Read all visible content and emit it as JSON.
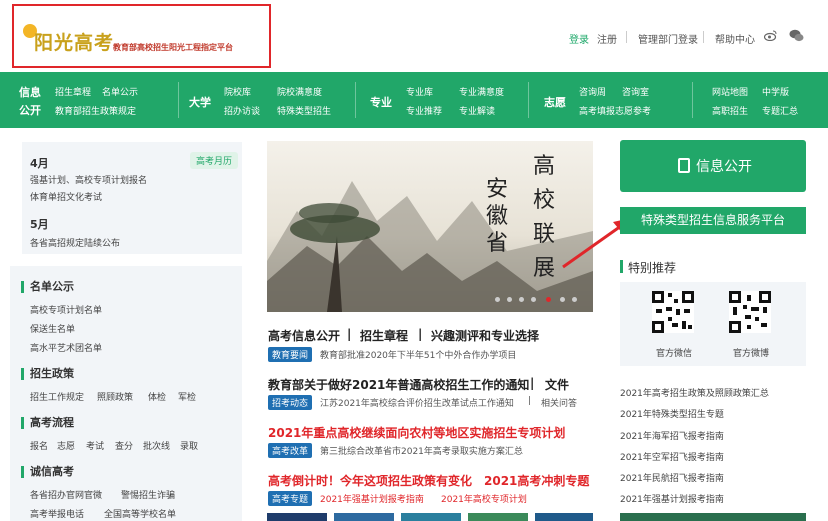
{
  "header": {
    "logo_text": "阳光高考",
    "logo_subtitle": "教育部高校招生阳光工程指定平台",
    "links": {
      "login": "登录",
      "register": "注册",
      "admin_login": "管理部门登录",
      "help": "帮助中心"
    }
  },
  "nav": {
    "groups": [
      {
        "title_line1": "信息",
        "title_line2": "公开",
        "items": [
          "招生章程",
          "名单公示",
          "教育部招生政策规定"
        ]
      },
      {
        "title": "大学",
        "items": [
          "院校库",
          "院校满意度",
          "招办访谈",
          "特殊类型招生"
        ]
      },
      {
        "title": "专业",
        "items": [
          "专业库",
          "专业满意度",
          "专业推荐",
          "专业解读"
        ]
      },
      {
        "title": "志愿",
        "items": [
          "咨询周",
          "咨询室",
          "高考填报志愿参考"
        ]
      },
      {
        "items": [
          "网站地图",
          "中学版",
          "高职招生",
          "专题汇总"
        ]
      }
    ]
  },
  "calendar": {
    "badge": "高考月历",
    "april": {
      "month": "4月",
      "lines": [
        "强基计划、高校专项计划报名",
        "体育单招文化考试"
      ]
    },
    "may": {
      "month": "5月",
      "lines": [
        "各省高招规定陆续公布"
      ]
    }
  },
  "left_sections": {
    "mingdan": {
      "title": "名单公示",
      "items": [
        "高校专项计划名单",
        "保送生名单",
        "高水平艺术团名单"
      ]
    },
    "zhengce": {
      "title": "招生政策",
      "items": [
        "招生工作规定",
        "照顾政策",
        "体检",
        "军检"
      ]
    },
    "liucheng": {
      "title": "高考流程",
      "items": [
        "报名",
        "志愿",
        "考试",
        "查分",
        "批次线",
        "录取"
      ]
    },
    "chengxin": {
      "title": "诚信高考",
      "items": [
        "各省招办官网官微",
        "警惕招生诈骗",
        "高考举报电话",
        "全国高等学校名单"
      ]
    }
  },
  "banner": {
    "col1": "安徽省",
    "col2": "高校联展",
    "dots": 7,
    "active_dot": 4
  },
  "news": [
    {
      "headline_parts": [
        "高考信息公开",
        "招生章程",
        "兴趣测评和专业选择"
      ],
      "tag": "教育要闻",
      "sub": [
        "教育部批准2020年下半年51个中外合作办学项目"
      ]
    },
    {
      "headline_parts": [
        "教育部关于做好2021年普通高校招生工作的通知",
        "文件"
      ],
      "tag": "招考动态",
      "sub": [
        "江苏2021年高校综合评价招生改革试点工作通知",
        "相关问答"
      ]
    },
    {
      "headline_red": "2021年重点高校继续面向农村等地区实施招生专项计划",
      "tag": "高考改革",
      "sub": [
        "第三批综合改革省市2021年高考录取实施方案汇总"
      ]
    },
    {
      "headline_red": "高考倒计时！今年这项招生政策有变化　2021高考冲刺专题",
      "tag": "高考专题",
      "sub_red": [
        "2021年强基计划报考指南",
        "2021年高校专项计划"
      ]
    }
  ],
  "right": {
    "info_button": "信息公开",
    "special_button": "特殊类型招生信息服务平台",
    "recommend_title": "特别推荐",
    "qr_labels": [
      "官方微信",
      "官方微博"
    ],
    "links": [
      "2021年高考招生政策及照顾政策汇总",
      "2021年特殊类型招生专题",
      "2021年海军招飞报考指南",
      "2021年空军招飞报考指南",
      "2021年民航招飞报考指南",
      "2021年强基计划报考指南"
    ]
  },
  "colors": {
    "brand_green": "#21a769",
    "accent_red": "#e0262a",
    "tag_blue": "#1f6fb2"
  }
}
